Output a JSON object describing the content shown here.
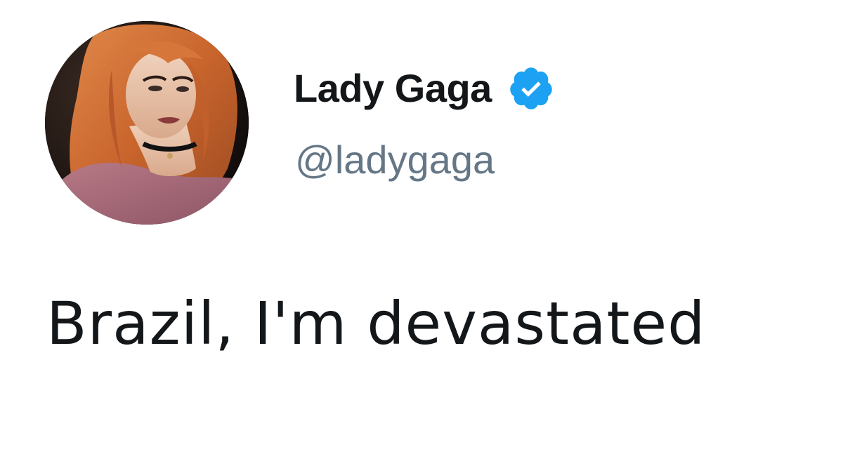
{
  "tweet": {
    "author": {
      "display_name": "Lady Gaga",
      "handle": "@ladygaga",
      "verified": true,
      "avatar_icon": "profile-photo",
      "verified_icon": "verified-badge-icon"
    },
    "text": "Brazil, I'm devastated"
  },
  "colors": {
    "text_primary": "#14171a",
    "text_secondary": "#657786",
    "verified_blue": "#1da1f2",
    "background": "#ffffff"
  }
}
